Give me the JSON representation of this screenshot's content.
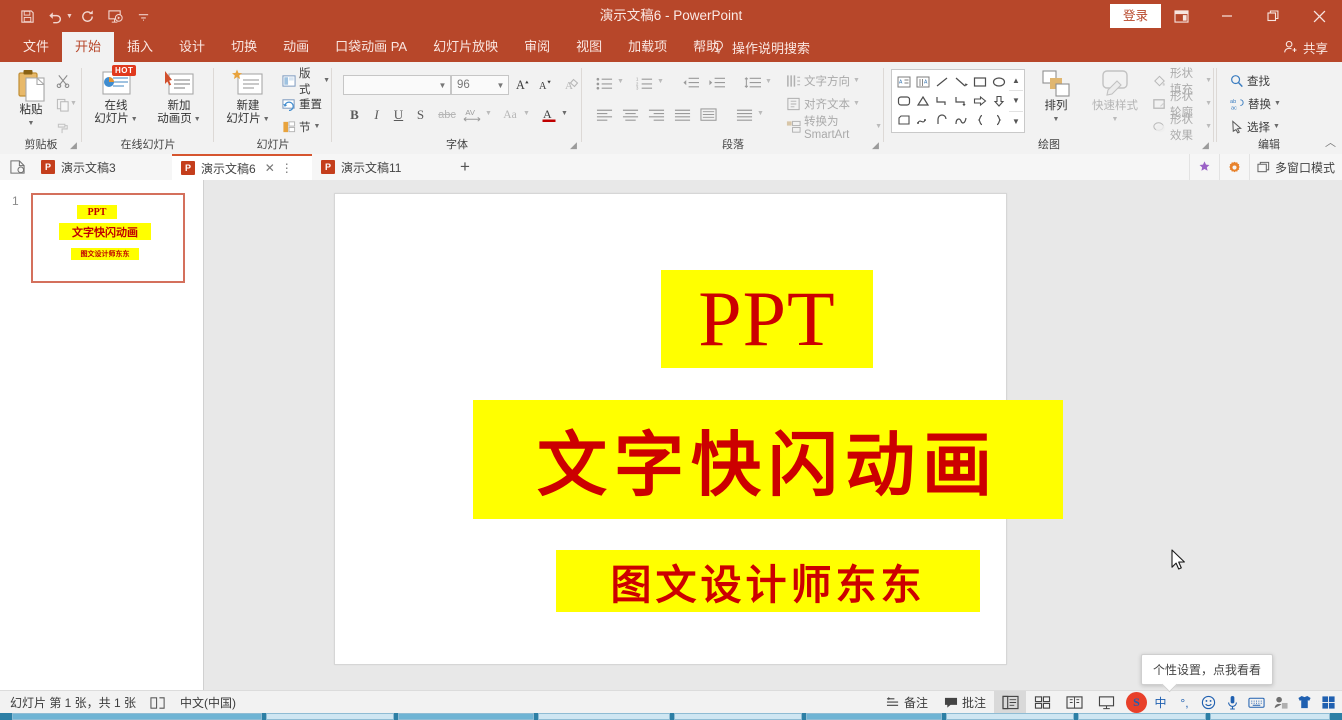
{
  "titlebar": {
    "document_title": "演示文稿6  -  PowerPoint",
    "signin_label": "登录",
    "qat": [
      {
        "name": "save-icon",
        "label": "保存"
      },
      {
        "name": "undo-icon",
        "label": "撤销"
      },
      {
        "name": "redo-icon",
        "label": "恢复"
      },
      {
        "name": "start-slideshow-icon",
        "label": "从头开始"
      },
      {
        "name": "customize-qat-icon",
        "label": "自定义快速访问工具栏"
      }
    ],
    "window_buttons": [
      {
        "name": "ribbon-display-options",
        "glyph": "▣"
      },
      {
        "name": "minimize",
        "glyph": "—"
      },
      {
        "name": "restore",
        "glyph": "❐"
      },
      {
        "name": "close",
        "glyph": "✕"
      }
    ]
  },
  "ribbon_tabs": {
    "items": [
      "文件",
      "开始",
      "插入",
      "设计",
      "切换",
      "动画",
      "口袋动画 PA",
      "幻灯片放映",
      "审阅",
      "视图",
      "加载项",
      "帮助"
    ],
    "active": "开始",
    "tell_me": "操作说明搜索",
    "share_label": "共享"
  },
  "ribbon": {
    "groups": [
      {
        "name": "clipboard",
        "label": "剪贴板",
        "paste_label": "粘贴",
        "items": [
          "剪切",
          "复制",
          "格式刷"
        ]
      },
      {
        "name": "online-slides",
        "label": "在线幻灯片",
        "buttons": [
          {
            "line1": "在线",
            "line2": "幻灯片",
            "badge": "HOT"
          },
          {
            "line1": "新加",
            "line2": "动画页"
          }
        ]
      },
      {
        "name": "slides",
        "label": "幻灯片",
        "new_slide": {
          "line1": "新建",
          "line2": "幻灯片"
        },
        "items": [
          {
            "label": "版式",
            "icon": "layout-icon"
          },
          {
            "label": "重置",
            "icon": "reset-icon"
          },
          {
            "label": "节",
            "icon": "section-icon"
          }
        ]
      },
      {
        "name": "font",
        "label": "字体",
        "font_name_value": "",
        "font_name_placeholder": "",
        "font_size_value": "96",
        "buttons": [
          "B",
          "I",
          "U",
          "S",
          "abc",
          "AV",
          "Aa",
          "A"
        ]
      },
      {
        "name": "paragraph",
        "label": "段落",
        "items": [
          {
            "label": "文字方向",
            "icon": "text-direction-icon"
          },
          {
            "label": "对齐文本",
            "icon": "align-text-icon"
          },
          {
            "label": "转换为 SmartArt",
            "icon": "smartart-icon"
          }
        ]
      },
      {
        "name": "drawing",
        "label": "绘图",
        "arrange_label": "排列",
        "quick_styles_label": "快速样式",
        "items": [
          {
            "label": "形状填充",
            "icon": "shape-fill-icon"
          },
          {
            "label": "形状轮廓",
            "icon": "shape-outline-icon"
          },
          {
            "label": "形状效果",
            "icon": "shape-effects-icon"
          }
        ]
      },
      {
        "name": "editing",
        "label": "编辑",
        "items": [
          {
            "label": "查找",
            "icon": "search-icon"
          },
          {
            "label": "替换",
            "icon": "replace-icon"
          },
          {
            "label": "选择",
            "icon": "select-icon"
          }
        ]
      }
    ]
  },
  "doc_tabs": {
    "items": [
      {
        "title": "演示文稿3",
        "active": false
      },
      {
        "title": "演示文稿6",
        "active": true
      },
      {
        "title": "演示文稿11",
        "active": false
      }
    ],
    "add_label": "+",
    "multi_window_label": "多窗口模式"
  },
  "slide_panel": {
    "slide_number": "1",
    "thumbnail": {
      "line1": "PPT",
      "line2": "文字快闪动画",
      "line3": "图文设计师东东"
    }
  },
  "slide": {
    "blocks": [
      {
        "text": "PPT",
        "bg": "#ffff00",
        "fg": "#cc0000"
      },
      {
        "text": "文字快闪动画",
        "bg": "#ffff00",
        "fg": "#cc0000"
      },
      {
        "text": "图文设计师东东",
        "bg": "#ffff00",
        "fg": "#cc0000"
      }
    ]
  },
  "tooltip": {
    "text": "个性设置，点我看看"
  },
  "statusbar": {
    "slide_count": "幻灯片 第 1 张，共 1 张",
    "language": "中文(中国)",
    "notes_label": "备注",
    "comments_label": "批注",
    "views": [
      {
        "name": "normal-view",
        "active": true
      },
      {
        "name": "slide-sorter-view",
        "active": false
      },
      {
        "name": "reading-view",
        "active": false
      },
      {
        "name": "slideshow-view",
        "active": false
      }
    ],
    "ime": {
      "brand": "S",
      "mode": "中"
    }
  },
  "colors": {
    "brand_red": "#b7472a",
    "highlight_yellow": "#ffff00",
    "text_red": "#cc0000",
    "ribbon_bg": "#f2f2f2"
  }
}
